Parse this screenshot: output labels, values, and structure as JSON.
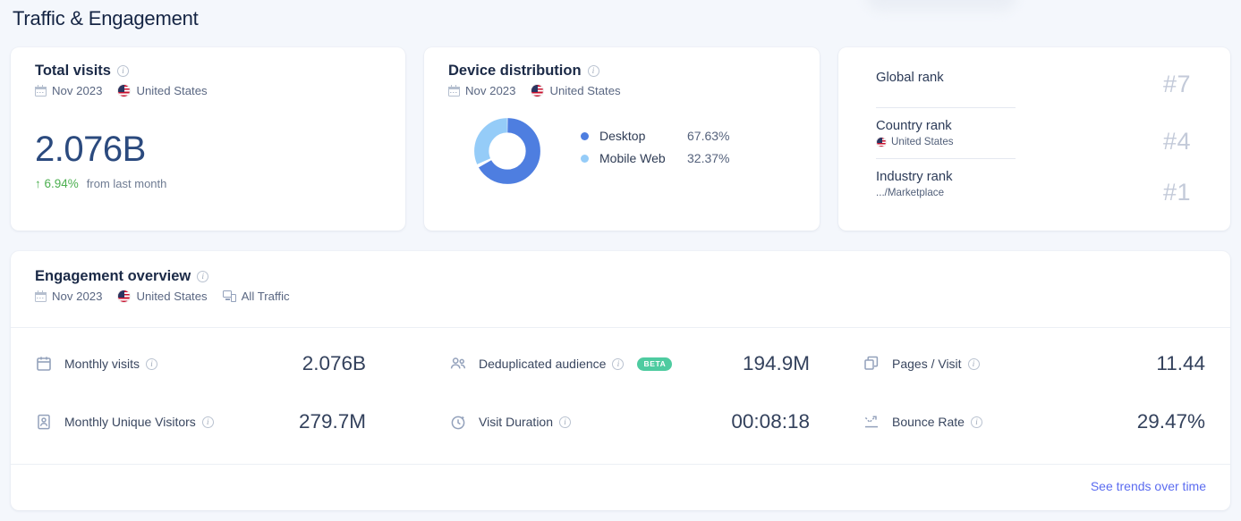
{
  "page": {
    "title": "Traffic & Engagement"
  },
  "colors": {
    "accent": "#5b6cf0",
    "desktop": "#4e7ee0",
    "mobile": "#95ccf8",
    "positive": "#4caf50",
    "beta_badge": "#4ecba0",
    "rank_value": "#c3cad9",
    "page_bg": "#f4f7fc"
  },
  "total_visits": {
    "title": "Total visits",
    "info_icon": "info-icon",
    "calendar_icon": "calendar-icon",
    "period": "Nov 2023",
    "flag_icon": "us-flag-icon",
    "country": "United States",
    "value": "2.076B",
    "delta_icon": "arrow-up-icon",
    "delta": "6.94%",
    "delta_note": "from last month"
  },
  "device_distribution": {
    "title": "Device distribution",
    "info_icon": "info-icon",
    "calendar_icon": "calendar-icon",
    "period": "Nov 2023",
    "flag_icon": "us-flag-icon",
    "country": "United States",
    "legend": [
      {
        "label": "Desktop",
        "value": "67.63%",
        "color": "#4e7ee0",
        "pct": 67.63
      },
      {
        "label": "Mobile Web",
        "value": "32.37%",
        "color": "#95ccf8",
        "pct": 32.37
      }
    ]
  },
  "ranks": [
    {
      "name": "Global rank",
      "sub": "",
      "value": "#7",
      "flag_icon": ""
    },
    {
      "name": "Country rank",
      "sub": "United States",
      "value": "#4",
      "flag_icon": "us-flag-icon"
    },
    {
      "name": "Industry rank",
      "sub": ".../Marketplace",
      "value": "#1",
      "flag_icon": ""
    }
  ],
  "engagement": {
    "title": "Engagement overview",
    "info_icon": "info-icon",
    "calendar_icon": "calendar-icon",
    "period": "Nov 2023",
    "flag_icon": "us-flag-icon",
    "country": "United States",
    "devices_icon": "devices-icon",
    "traffic": "All Traffic",
    "metrics": [
      {
        "icon": "calendar-metric-icon",
        "label": "Monthly visits",
        "value": "2.076B",
        "badge": ""
      },
      {
        "icon": "users-icon",
        "label": "Deduplicated audience",
        "value": "194.9M",
        "badge": "BETA"
      },
      {
        "icon": "pages-icon",
        "label": "Pages / Visit",
        "value": "11.44",
        "badge": ""
      },
      {
        "icon": "unique-visitor-icon",
        "label": "Monthly Unique Visitors",
        "value": "279.7M",
        "badge": ""
      },
      {
        "icon": "stopwatch-icon",
        "label": "Visit Duration",
        "value": "00:08:18",
        "badge": ""
      },
      {
        "icon": "bounce-icon",
        "label": "Bounce Rate",
        "value": "29.47%",
        "badge": ""
      }
    ],
    "trends_link": "See trends over time"
  },
  "chart_data": {
    "type": "pie",
    "title": "Device distribution",
    "categories": [
      "Desktop",
      "Mobile Web"
    ],
    "values": [
      67.63,
      32.37
    ],
    "colors": [
      "#4e7ee0",
      "#95ccf8"
    ],
    "unit": "%",
    "legend_position": "right",
    "donut": true
  }
}
